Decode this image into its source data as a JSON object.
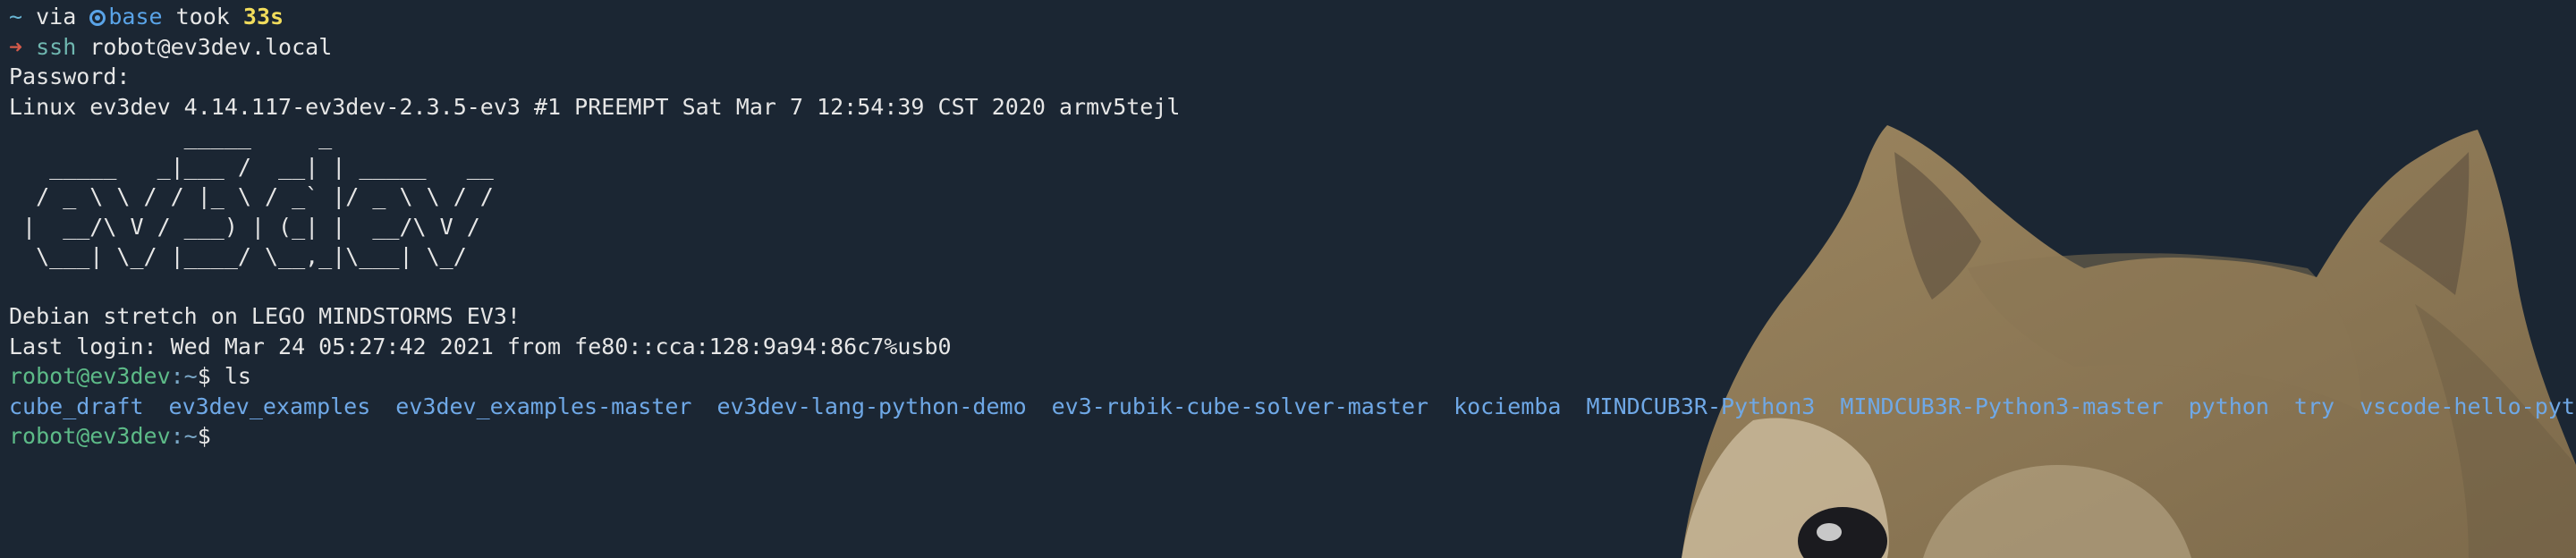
{
  "prompt": {
    "tilde": "~",
    "via": "via",
    "env_name": "base",
    "took": "took",
    "duration": "33s"
  },
  "command_line": {
    "arrow": "➜",
    "command": "ssh",
    "args": "robot@ev3dev.local"
  },
  "password_prompt": "Password:",
  "uname_line": "Linux ev3dev 4.14.117-ev3dev-2.3.5-ev3 #1 PREEMPT Sat Mar 7 12:54:39 CST 2020 armv5tejl",
  "ascii_banner": [
    "             _____     _",
    "   _____   _|___ /  __| | _____   __",
    "  / _ \\ \\ / / |_ \\ / _` |/ _ \\ \\ / /",
    " |  __/\\ V / ___) | (_| |  __/\\ V /",
    "  \\___| \\_/ |____/ \\__,_|\\___| \\_/"
  ],
  "motd": "Debian stretch on LEGO MINDSTORMS EV3!",
  "last_login": "Last login: Wed Mar 24 05:27:42 2021 from fe80::cca:128:9a94:86c7%usb0",
  "remote_prompt": {
    "user_host": "robot@ev3dev",
    "path": ":~",
    "symbol": "$ ",
    "command": "ls"
  },
  "ls_output": [
    "cube_draft",
    "ev3dev_examples",
    "ev3dev_examples-master",
    "ev3dev-lang-python-demo",
    "ev3-rubik-cube-solver-master",
    "kociemba",
    "MINDCUB3R-Python3",
    "MINDCUB3R-Python3-master",
    "python",
    "try",
    "vscode-hello-python-master"
  ],
  "final_prompt": {
    "user_host": "robot@ev3dev",
    "path": ":~",
    "symbol": "$"
  },
  "colors": {
    "background": "#1b2633",
    "prompt_green": "#5dbb88",
    "directory_blue": "#6fa8e6",
    "duration_yellow": "#f1dc5c",
    "arrow_red": "#d55a4a"
  },
  "background_image": "shiba-inu-dog-wallpaper"
}
